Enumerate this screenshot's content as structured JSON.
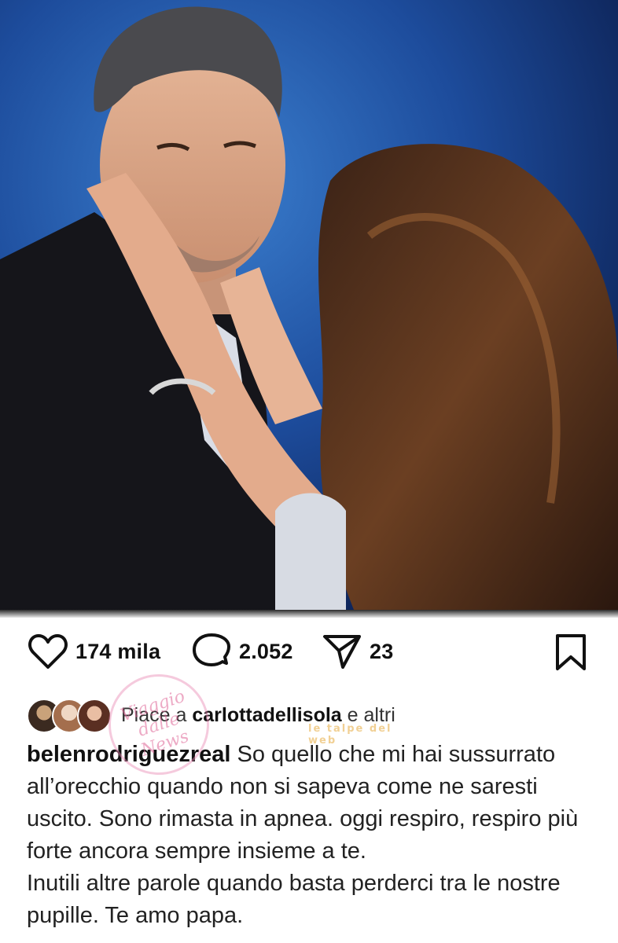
{
  "post": {
    "image_alt": "photo of a man and a woman embracing"
  },
  "actions": {
    "likes_count": "174 mila",
    "comments_count": "2.052",
    "shares_count": "23"
  },
  "liked_by": {
    "prefix": "Piace a ",
    "user": "carlottadellisola",
    "suffix": " e altri"
  },
  "caption": {
    "author": "belenrodriguezreal",
    "text": " So quello che mi hai sussurrato all’orecchio quando non si sapeva come ne saresti uscito. Sono rimasta in apnea. oggi respiro, respiro più forte ancora sempre insieme a te.",
    "text2": "Inutili altre parole quando basta perderci tra le nostre pupille. Te amo papa."
  },
  "watermarks": {
    "left": "Viaggio dalle News",
    "right": "le talpe del web"
  },
  "icons": {
    "like": "heart-icon",
    "comment": "comment-icon",
    "share": "paper-plane-icon",
    "save": "bookmark-icon"
  }
}
